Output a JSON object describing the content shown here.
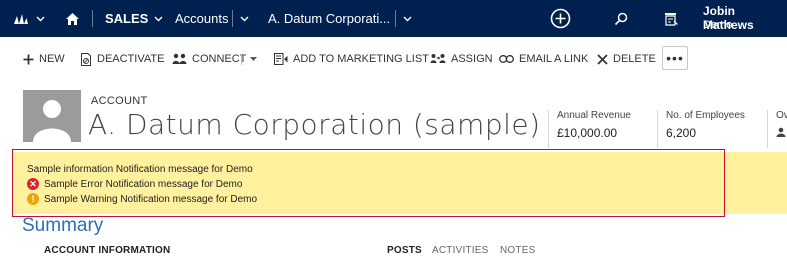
{
  "nav": {
    "app": "SALES",
    "area": "Accounts",
    "record": "A. Datum Corporati...",
    "user_name": "Jobin Mathews",
    "user_org": "Demo"
  },
  "commands": {
    "new": "NEW",
    "deactivate": "DEACTIVATE",
    "connect": "CONNECT",
    "add_to_marketing_list": "ADD TO MARKETING LIST",
    "assign": "ASSIGN",
    "email_a_link": "EMAIL A LINK",
    "delete": "DELETE",
    "more": "•••"
  },
  "record": {
    "entity": "ACCOUNT",
    "title": "A. Datum Corporation (sample)",
    "fields": [
      {
        "label": "Annual Revenue",
        "value": "£10,000.00"
      },
      {
        "label": "No. of Employees",
        "value": "6,200"
      },
      {
        "label": "Ov",
        "value": ""
      }
    ]
  },
  "notifications": {
    "info": "Sample information Notification message for Demo",
    "error": "Sample Error Notification message for Demo",
    "warning": "Sample Warning Notification message for Demo"
  },
  "summary": {
    "heading": "Summary",
    "section": "ACCOUNT INFORMATION",
    "tabs": [
      "POSTS",
      "ACTIVITIES",
      "NOTES"
    ]
  },
  "colors": {
    "nav_bg": "#002050",
    "notif_bg": "#fff19d",
    "highlight_border": "#c8102e",
    "error": "#d9232e",
    "warning": "#f0a30a",
    "summary_blue": "#2f6eb5"
  }
}
